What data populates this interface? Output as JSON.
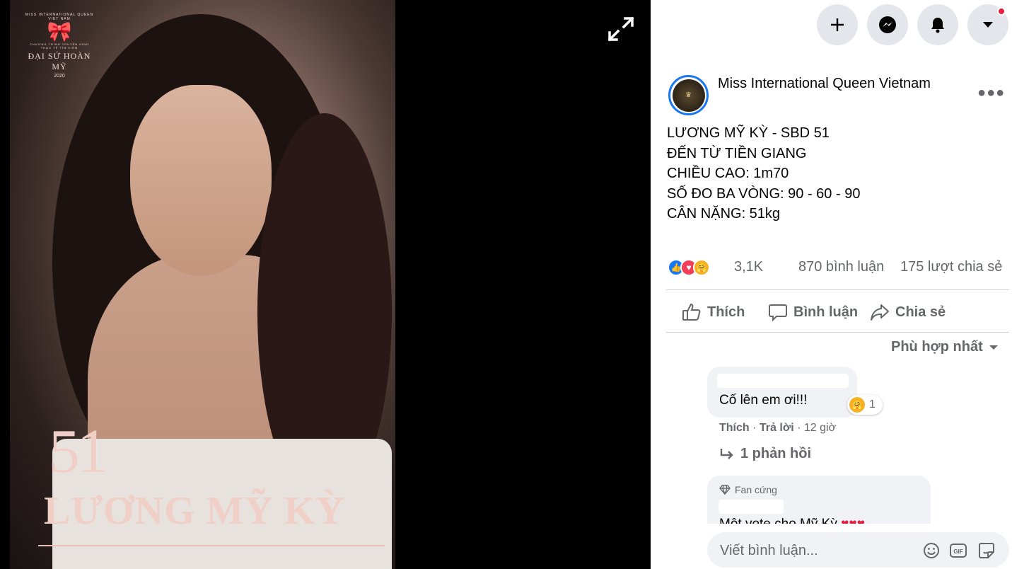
{
  "poster": {
    "logo_arc": "MISS INTERNATIONAL QUEEN VIET NAM",
    "logo_sub": "CHƯƠNG TRÌNH TRUYỀN HÌNH THỰC TẾ TÌM KIẾM",
    "logo_brand": "ĐẠI SỨ HOÀN MỸ",
    "logo_year": "2020",
    "number": "51",
    "name": "LƯƠNG MỸ KỲ"
  },
  "post": {
    "page_name": "Miss International Queen Vietnam",
    "caption_lines": [
      "LƯƠNG MỸ KỲ - SBD 51",
      "ĐẾN TỪ TIỀN GIANG",
      "CHIỀU CAO: 1m70",
      "SỐ ĐO BA VÒNG: 90 - 60 - 90",
      "CÂN NẶNG: 51kg"
    ],
    "reaction_count": "3,1K",
    "comment_count": "870 bình luận",
    "share_count": "175 lượt chia sẻ"
  },
  "actions": {
    "like": "Thích",
    "comment": "Bình luận",
    "share": "Chia sẻ"
  },
  "sort_label": "Phù hợp nhất",
  "comments": [
    {
      "text": "Cố lên em ơi!!!",
      "reaction_count": "1",
      "like": "Thích",
      "reply": "Trả lời",
      "time": "12 giờ",
      "replies": "1 phản hồi"
    },
    {
      "badge": "Fan cứng",
      "text": "Một vote cho Mỹ Kỳ"
    }
  ],
  "composer_placeholder": "Viết bình luận...",
  "colors": {
    "accent": "#1877f2",
    "notification": "#e41e3f"
  }
}
